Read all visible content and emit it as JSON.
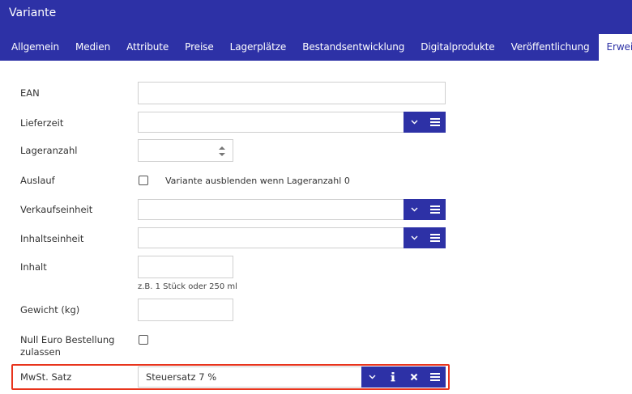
{
  "window": {
    "title": "Variante"
  },
  "tabs": [
    {
      "label": "Allgemein"
    },
    {
      "label": "Medien"
    },
    {
      "label": "Attribute"
    },
    {
      "label": "Preise"
    },
    {
      "label": "Lagerplätze"
    },
    {
      "label": "Bestandsentwicklung"
    },
    {
      "label": "Digitalprodukte"
    },
    {
      "label": "Veröffentlichung"
    },
    {
      "label": "Erweitert"
    }
  ],
  "active_tab": "Erweitert",
  "form": {
    "ean": {
      "label": "EAN",
      "value": ""
    },
    "lieferzeit": {
      "label": "Lieferzeit",
      "value": ""
    },
    "lageranzahl": {
      "label": "Lageranzahl",
      "value": ""
    },
    "auslauf": {
      "label": "Auslauf",
      "checkbox_label": "Variante ausblenden wenn Lageranzahl 0",
      "checked": false
    },
    "verkaufseinheit": {
      "label": "Verkaufseinheit",
      "value": ""
    },
    "inhaltseinheit": {
      "label": "Inhaltseinheit",
      "value": ""
    },
    "inhalt": {
      "label": "Inhalt",
      "value": "",
      "hint": "z.B. 1 Stück oder 250 ml"
    },
    "gewicht": {
      "label": "Gewicht (kg)",
      "value": ""
    },
    "null_euro": {
      "label_line1": "Null Euro Bestellung",
      "label_line2": "zulassen",
      "checked": false
    },
    "mwst": {
      "label": "MwSt. Satz",
      "value": "Steuersatz 7 %"
    }
  },
  "colors": {
    "header": "#2d31a6",
    "button": "#2d31a6",
    "highlight": "#e8341c"
  },
  "icons": [
    "chevron-down-icon",
    "list-icon",
    "info-icon",
    "close-icon",
    "stepper-icon"
  ]
}
